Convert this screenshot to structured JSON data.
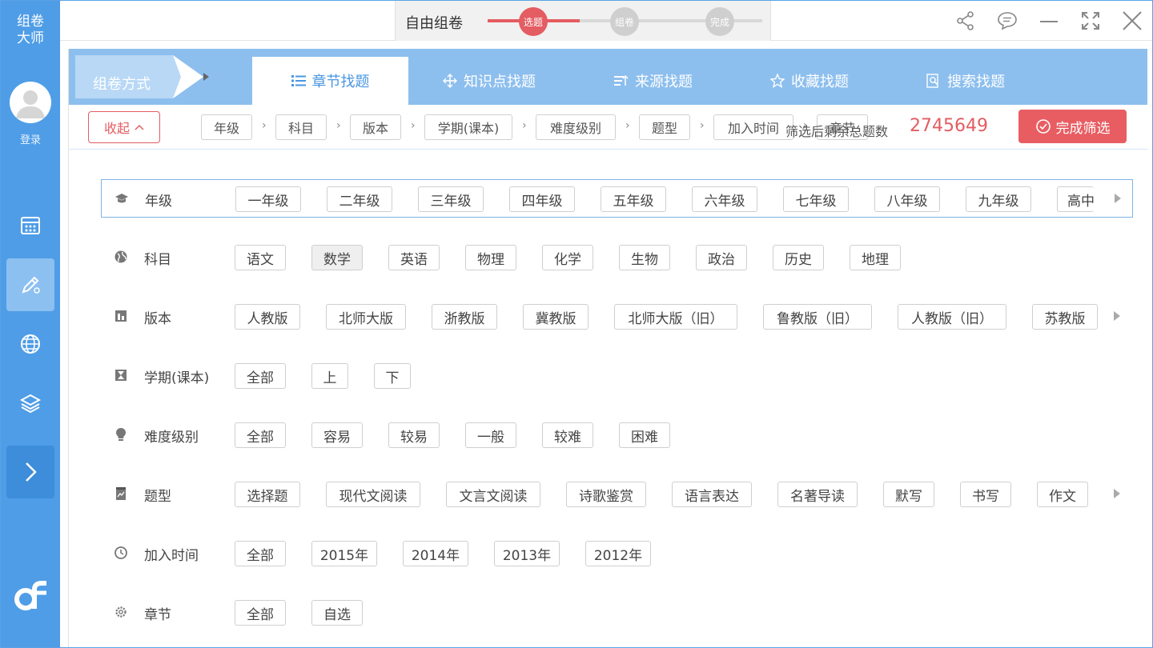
{
  "sidebar": {
    "brand": "组卷\n大师",
    "login": "登录",
    "items": [
      {
        "icon": "calendar-icon"
      },
      {
        "icon": "pencil-icon"
      },
      {
        "icon": "globe-icon"
      },
      {
        "icon": "layers-icon"
      },
      {
        "icon": "chevron-right-icon"
      }
    ]
  },
  "topbar": {
    "wizard_title": "自由组卷",
    "steps": [
      "选题",
      "组卷",
      "完成"
    ],
    "icons": [
      "share-icon",
      "comment-icon",
      "minimize-icon",
      "fullscreen-icon",
      "close-icon"
    ]
  },
  "tabs": {
    "ribbon": "组卷方式",
    "items": [
      "章节找题",
      "知识点找题",
      "来源找题",
      "收藏找题",
      "搜索找题"
    ]
  },
  "crumbs": {
    "collapse": "收起",
    "items": [
      "年级",
      "科目",
      "版本",
      "学期(课本)",
      "难度级别",
      "题型",
      "加入时间",
      "章节"
    ],
    "total_label": "筛选后剩余总题数",
    "total_value": "2745649",
    "finish": "完成筛选"
  },
  "filters": [
    {
      "label": "年级",
      "options": [
        "一年级",
        "二年级",
        "三年级",
        "四年级",
        "五年级",
        "六年级",
        "七年级",
        "八年级",
        "九年级",
        "高中"
      ]
    },
    {
      "label": "科目",
      "options": [
        "语文",
        "数学",
        "英语",
        "物理",
        "化学",
        "生物",
        "政治",
        "历史",
        "地理"
      ]
    },
    {
      "label": "版本",
      "options": [
        "人教版",
        "北师大版",
        "浙教版",
        "冀教版",
        "北师大版（旧）",
        "鲁教版（旧）",
        "人教版（旧）",
        "苏教版"
      ]
    },
    {
      "label": "学期(课本)",
      "options": [
        "全部",
        "上",
        "下"
      ]
    },
    {
      "label": "难度级别",
      "options": [
        "全部",
        "容易",
        "较易",
        "一般",
        "较难",
        "困难"
      ]
    },
    {
      "label": "题型",
      "options": [
        "选择题",
        "现代文阅读",
        "文言文阅读",
        "诗歌鉴赏",
        "语言表达",
        "名著导读",
        "默写",
        "书写",
        "作文"
      ]
    },
    {
      "label": "加入时间",
      "options": [
        "全部",
        "2015年",
        "2014年",
        "2013年",
        "2012年"
      ]
    },
    {
      "label": "章节",
      "options": [
        "全部",
        "自选"
      ]
    }
  ],
  "colors": {
    "accent": "#4f9de6",
    "danger": "#e35d62"
  }
}
